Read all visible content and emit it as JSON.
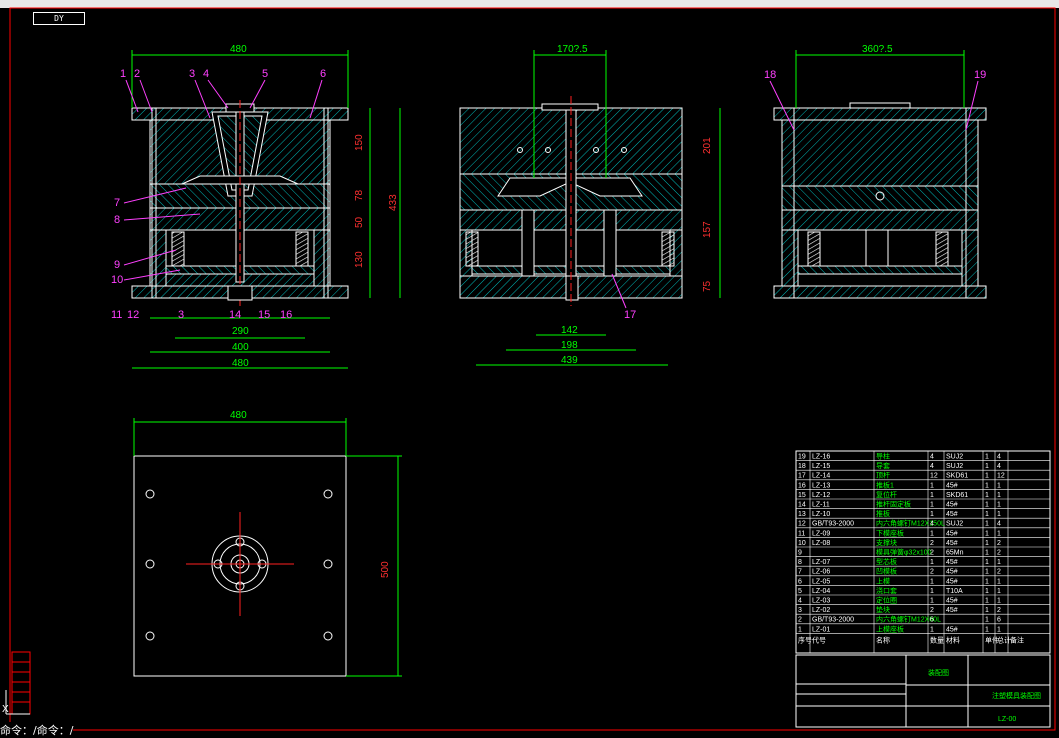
{
  "window": {
    "tab_label": "DY"
  },
  "colors": {
    "outline": "#ffffff",
    "dimension": "#00ff00",
    "hatch": "#00cccc",
    "balloon": "#ff40ff",
    "center": "#ff2020",
    "border": "#ff0000"
  },
  "front_view": {
    "dims_top": [
      "480"
    ],
    "dims_right": [
      "150",
      "78",
      "50",
      "130",
      "433"
    ],
    "dims_bottom": [
      "290",
      "400",
      "480"
    ],
    "balloons_top": [
      "1",
      "2",
      "3",
      "4",
      "5",
      "6"
    ],
    "balloons_left": [
      "7",
      "8",
      "9",
      "10",
      "11",
      "12"
    ],
    "balloons_bottom": [
      "3",
      "14",
      "15",
      "16"
    ]
  },
  "side_view": {
    "dims_top": [
      "170?.5"
    ],
    "dims_right": [
      "201",
      "157",
      "75"
    ],
    "dims_bottom": [
      "142",
      "198",
      "439"
    ],
    "balloons": [
      "17"
    ]
  },
  "end_view": {
    "dims_top": [
      "360?.5"
    ],
    "balloons": [
      "18",
      "19"
    ]
  },
  "plan_view": {
    "dims_top": [
      "480"
    ],
    "dims_right": [
      "500"
    ]
  },
  "bom": {
    "rows": [
      [
        "19",
        "LZ-16",
        "导柱",
        "4",
        "SUJ2",
        "1",
        "4"
      ],
      [
        "18",
        "LZ-15",
        "导套",
        "4",
        "SUJ2",
        "1",
        "4"
      ],
      [
        "17",
        "LZ-14",
        "顶杆",
        "12",
        "SKD61",
        "1",
        "12"
      ],
      [
        "16",
        "LZ-13",
        "推板1",
        "1",
        "45#",
        "1",
        "1"
      ],
      [
        "15",
        "LZ-12",
        "复位杆",
        "1",
        "SKD61",
        "1",
        "1"
      ],
      [
        "14",
        "LZ-11",
        "推杆固定板",
        "1",
        "45#",
        "1",
        "1"
      ],
      [
        "13",
        "LZ-10",
        "推板",
        "1",
        "45#",
        "1",
        "1"
      ],
      [
        "12",
        "GB/T93-2000",
        "内六角螺钉M12X150L",
        "4",
        "SUJ2",
        "1",
        "4"
      ],
      [
        "11",
        "LZ-09",
        "下模座板",
        "1",
        "45#",
        "1",
        "1"
      ],
      [
        "10",
        "LZ-08",
        "支撑块",
        "2",
        "45#",
        "1",
        "2"
      ],
      [
        "9",
        "",
        "模具弹簧φ32x100",
        "2",
        "65Mn",
        "1",
        "2"
      ],
      [
        "8",
        "LZ-07",
        "型芯板",
        "1",
        "45#",
        "1",
        "1"
      ],
      [
        "7",
        "LZ-06",
        "凹模板",
        "2",
        "45#",
        "1",
        "2"
      ],
      [
        "6",
        "LZ-05",
        "上模",
        "1",
        "45#",
        "1",
        "1"
      ],
      [
        "5",
        "LZ-04",
        "浇口套",
        "1",
        "T10A",
        "1",
        "1"
      ],
      [
        "4",
        "LZ-03",
        "定位圈",
        "1",
        "45#",
        "1",
        "1"
      ],
      [
        "3",
        "LZ-02",
        "垫块",
        "2",
        "45#",
        "1",
        "2"
      ],
      [
        "2",
        "GB/T93-2000",
        "内六角螺钉M12X60L",
        "6",
        "",
        "1",
        "6"
      ],
      [
        "1",
        "LZ-01",
        "上模座板",
        "1",
        "45#",
        "1",
        "1"
      ]
    ],
    "header": [
      "序号",
      "代号",
      "名称",
      "数量",
      "材料",
      "单件",
      "总计",
      "备注"
    ],
    "title": "装配图",
    "drawing_no": "LZ-00",
    "part_name": "注塑模具装配图"
  },
  "status": {
    "command_line": "命令：/命令：/"
  }
}
